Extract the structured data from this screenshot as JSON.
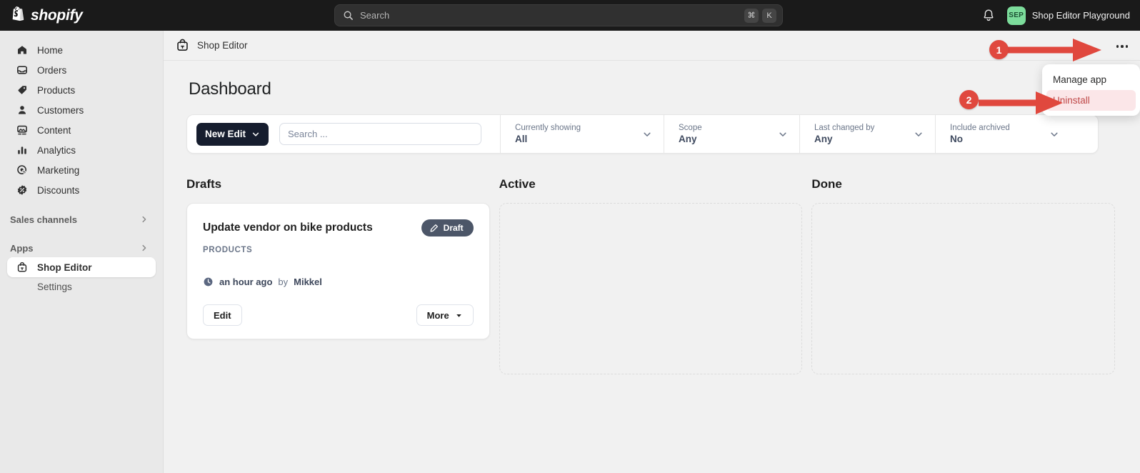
{
  "topbar": {
    "brand": "shopify",
    "search": {
      "placeholder": "Search",
      "value": "",
      "kbd_cmd": "⌘",
      "kbd_key": "K"
    },
    "notifications_icon": "bell-icon",
    "account": {
      "initials": "SEP",
      "name": "Shop Editor Playground",
      "avatar_color": "#7cdc9b"
    }
  },
  "sidebar": {
    "items": [
      {
        "label": "Home",
        "icon": "home-icon"
      },
      {
        "label": "Orders",
        "icon": "orders-inbox-icon"
      },
      {
        "label": "Products",
        "icon": "product-tag-icon"
      },
      {
        "label": "Customers",
        "icon": "person-icon"
      },
      {
        "label": "Content",
        "icon": "content-image-icon"
      },
      {
        "label": "Analytics",
        "icon": "bar-chart-icon"
      },
      {
        "label": "Marketing",
        "icon": "marketing-target-icon"
      },
      {
        "label": "Discounts",
        "icon": "discount-badge-icon"
      }
    ],
    "groups": [
      {
        "label": "Sales channels",
        "icon": "chevron-right-icon"
      },
      {
        "label": "Apps",
        "icon": "chevron-right-icon"
      }
    ],
    "app_active": {
      "label": "Shop Editor",
      "icon": "shop-bag-icon"
    },
    "app_sub": {
      "label": "Settings"
    }
  },
  "app_header": {
    "title": "Shop Editor",
    "icon": "shop-bag-icon",
    "kebab_icon": "ellipsis-icon"
  },
  "page": {
    "title": "Dashboard"
  },
  "toolbar": {
    "new_edit_label": "New Edit",
    "new_edit_icon": "chevron-down-icon",
    "search_placeholder": "Search ...",
    "search_value": "",
    "filters": [
      {
        "label": "Currently showing",
        "value": "All",
        "icon": "chevron-down-icon"
      },
      {
        "label": "Scope",
        "value": "Any",
        "icon": "chevron-down-icon"
      },
      {
        "label": "Last changed by",
        "value": "Any",
        "icon": "chevron-down-icon"
      },
      {
        "label": "Include archived",
        "value": "No",
        "icon": "chevron-down-icon"
      }
    ]
  },
  "board": {
    "columns": [
      {
        "title": "Drafts"
      },
      {
        "title": "Active"
      },
      {
        "title": "Done"
      }
    ],
    "draft_card": {
      "title": "Update vendor on bike products",
      "badge": {
        "label": "Draft",
        "icon": "pencil-icon",
        "color": "#4c5668"
      },
      "kind": "PRODUCTS",
      "meta_icon": "clock-icon",
      "meta_time": "an hour ago",
      "meta_by": "by",
      "meta_author": "Mikkel",
      "edit_label": "Edit",
      "more_label": "More",
      "more_icon": "caret-down-icon"
    }
  },
  "menu": {
    "items": [
      {
        "label": "Manage app",
        "danger": false
      },
      {
        "label": "Uninstall",
        "danger": true
      }
    ]
  },
  "annotations": [
    {
      "number": "1",
      "color": "#e0483e"
    },
    {
      "number": "2",
      "color": "#e0483e"
    }
  ]
}
